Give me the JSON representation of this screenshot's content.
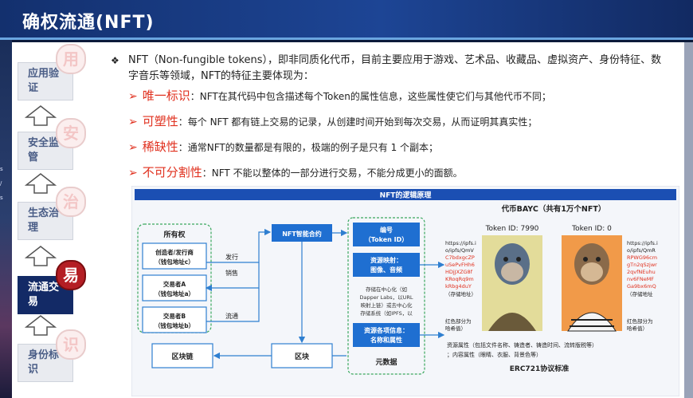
{
  "header": {
    "title": "确权流通(NFT)"
  },
  "edge_labels": [
    "s",
    "/",
    "s"
  ],
  "sidebar": {
    "items": [
      {
        "label": "应用验证",
        "badge": "用"
      },
      {
        "label": "安全监管",
        "badge": "安"
      },
      {
        "label": "生态治理",
        "badge": "治"
      },
      {
        "label": "流通交易",
        "badge": "易"
      },
      {
        "label": "身份标识",
        "badge": "识"
      }
    ]
  },
  "intro": {
    "bullet": "❖",
    "text": "NFT（Non-fungible tokens），即非同质化代币，目前主要应用于游戏、艺术品、收藏品、虚拟资产、身份特征、数字音乐等领域，NFT的特征主要体现为："
  },
  "features": [
    {
      "key": "唯一标识",
      "sep": "：",
      "desc": "NFT在其代码中包含描述每个Token的属性信息，这些属性使它们与其他代币不同；"
    },
    {
      "key": "可塑性",
      "sep": "：",
      "desc": "每个 NFT 都有链上交易的记录，从创建时间开始到每次交易，从而证明其真实性；"
    },
    {
      "key": "稀缺性",
      "sep": "：",
      "desc": "通常NFT的数量都是有限的，极端的例子是只有 1 个副本；"
    },
    {
      "key": "不可分割性",
      "sep": "：",
      "desc": "NFT 不能以整体的一部分进行交易，不能分成更小的面额。"
    }
  ],
  "diagram": {
    "title": "NFT的逻辑原理",
    "ownership": {
      "title": "所有权",
      "boxes": [
        [
          "创造者/发行商",
          "（钱包地址c）"
        ],
        [
          "交易者A",
          "（钱包地址a）"
        ],
        [
          "交易者B",
          "（钱包地址b）"
        ]
      ]
    },
    "labels": {
      "issue": "发行",
      "sell": "销售",
      "circulate": "流通"
    },
    "contract": "NFT智能合约",
    "blockchain": "区块链",
    "block": "区块",
    "metadata": {
      "id_box": [
        "编号",
        "（Token ID）"
      ],
      "resource_box": [
        "资源映射：",
        "图像、音频"
      ],
      "storage_text": [
        "存储在中心化（如",
        "Dapper Labs，以URL",
        "映射上链）或去中心化",
        "存储系统（如IPFS，以"
      ],
      "attr_box": [
        "资源各项信息：",
        "名称和属性"
      ],
      "label": "元数据"
    },
    "bayc": {
      "title": "代币BAYC（共有1万个NFT）",
      "token1": "Token ID: 7990",
      "token2": "Token ID: 0",
      "left_url": [
        "https://ipfs.i",
        "o/ipfs/QmV",
        "C7bdxgcZP",
        "uSePvFHh6",
        "HDjJXZG8f",
        "KRoqRq9m",
        "kRbg4duY"
      ],
      "left_url_note": "（存储地址）",
      "right_url": [
        "https://ipfs.i",
        "o/ipfs/QmR",
        "RPWG96cm",
        "gTn2qSzjwr",
        "2qvfNEuhu",
        "nv6FNeMF",
        "Ga9bx6mQ"
      ],
      "right_url_note": "（存储地址",
      "red_note_left": [
        "红色部分为",
        "哈希值）"
      ],
      "red_note_right": [
        "红色部分为",
        "哈希值）"
      ],
      "attr_line1": "资源属性（包括文件名称、铸造者、铸造时间、流转版税等）",
      "attr_line2": "；内容属性（眼睛、衣服、背景色等）",
      "standard": "ERC721协议标准"
    }
  }
}
